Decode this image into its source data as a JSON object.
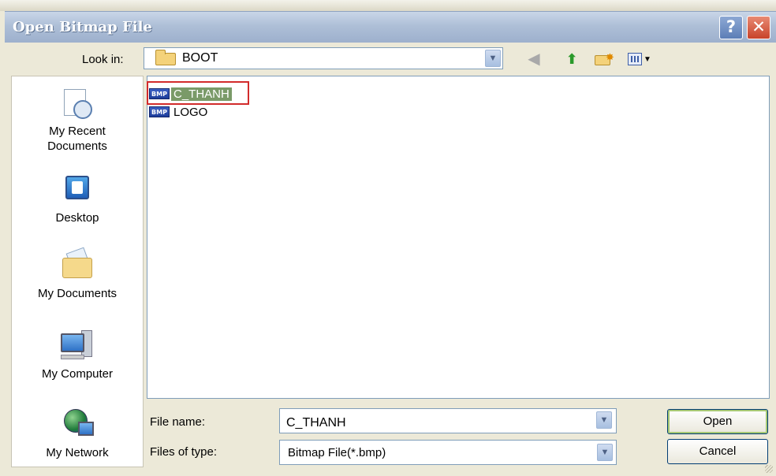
{
  "window": {
    "title": "Open Bitmap File",
    "help_glyph": "?",
    "close_glyph": "✕"
  },
  "toolbar": {
    "look_in_label": "Look in:",
    "look_in_value": "BOOT",
    "back_icon": "back-arrow-icon",
    "up_icon": "up-folder-icon",
    "new_folder_icon": "new-folder-icon",
    "views_icon": "views-menu-icon"
  },
  "places": [
    {
      "label_line1": "My Recent",
      "label_line2": "Documents",
      "icon": "recent-documents-icon"
    },
    {
      "label_line1": "Desktop",
      "label_line2": "",
      "icon": "desktop-icon"
    },
    {
      "label_line1": "My Documents",
      "label_line2": "",
      "icon": "my-documents-icon"
    },
    {
      "label_line1": "My Computer",
      "label_line2": "",
      "icon": "my-computer-icon"
    },
    {
      "label_line1": "My Network",
      "label_line2": "",
      "icon": "my-network-icon"
    }
  ],
  "files": [
    {
      "name": "C_THANH",
      "type_badge": "BMP",
      "selected": true
    },
    {
      "name": "LOGO",
      "type_badge": "BMP",
      "selected": false
    }
  ],
  "form": {
    "file_name_label": "File name:",
    "file_name_value": "C_THANH",
    "file_type_label": "Files of type:",
    "file_type_value": "Bitmap File(*.bmp)"
  },
  "buttons": {
    "open": "Open",
    "cancel": "Cancel"
  },
  "colors": {
    "title_bar": "#aebfd7",
    "selection": "#7a9a68",
    "highlight_box": "#d22b2b",
    "close_button": "#c8432a"
  }
}
